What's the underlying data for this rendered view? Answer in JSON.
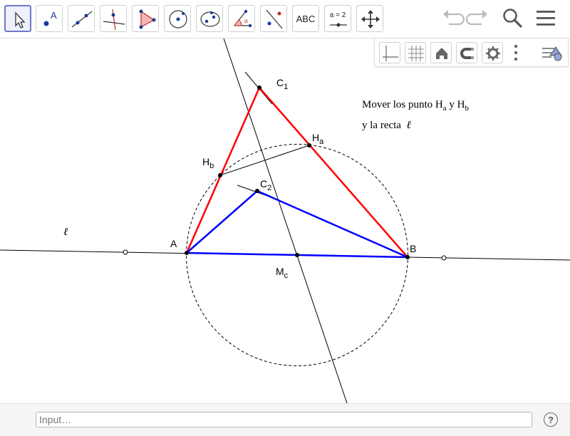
{
  "toolbar": {
    "tools": [
      {
        "name": "move",
        "icon": "arrow-cursor-icon"
      },
      {
        "name": "point",
        "icon": "point-icon",
        "label": "A"
      },
      {
        "name": "line",
        "icon": "line-icon"
      },
      {
        "name": "perpendicular",
        "icon": "perpendicular-line-icon"
      },
      {
        "name": "polygon",
        "icon": "polygon-icon"
      },
      {
        "name": "circle",
        "icon": "circle-center-icon"
      },
      {
        "name": "ellipse",
        "icon": "conic-icon"
      },
      {
        "name": "angle",
        "icon": "angle-icon"
      },
      {
        "name": "reflect",
        "icon": "reflect-icon"
      },
      {
        "name": "text",
        "icon": "text-icon",
        "label": "ABC"
      },
      {
        "name": "slider",
        "icon": "slider-icon",
        "label": "a = 2"
      },
      {
        "name": "move-graphics",
        "icon": "move-graphics-icon"
      }
    ],
    "right_icons": [
      "undo-icon",
      "redo-icon",
      "search-icon",
      "menu-icon"
    ]
  },
  "stylebar": {
    "buttons": [
      "axes-icon",
      "grid-icon",
      "home-icon",
      "magnet-icon",
      "gear-icon",
      "more-icon",
      "properties-icon"
    ]
  },
  "construction": {
    "points": {
      "A": {
        "label": "A"
      },
      "B": {
        "label": "B"
      },
      "C1": {
        "label": "C",
        "sub": "1"
      },
      "C2": {
        "label": "C",
        "sub": "2"
      },
      "Ha": {
        "label": "H",
        "sub": "a"
      },
      "Hb": {
        "label": "H",
        "sub": "b"
      },
      "Mc": {
        "label": "M",
        "sub": "c"
      }
    },
    "line_label": "ℓ",
    "colors": {
      "triangle1": "#ff0000",
      "triangle2": "#0000ff",
      "base": "#0000ff",
      "lines": "#000000"
    }
  },
  "note": {
    "line1_prefix": "Mover los punto H",
    "line1_sub1": "a",
    "line1_mid": " y H",
    "line1_sub2": "b",
    "line2": "y la recta",
    "line2_symbol": "ℓ"
  },
  "input": {
    "placeholder": "Input…"
  },
  "help": {
    "label": "?"
  }
}
